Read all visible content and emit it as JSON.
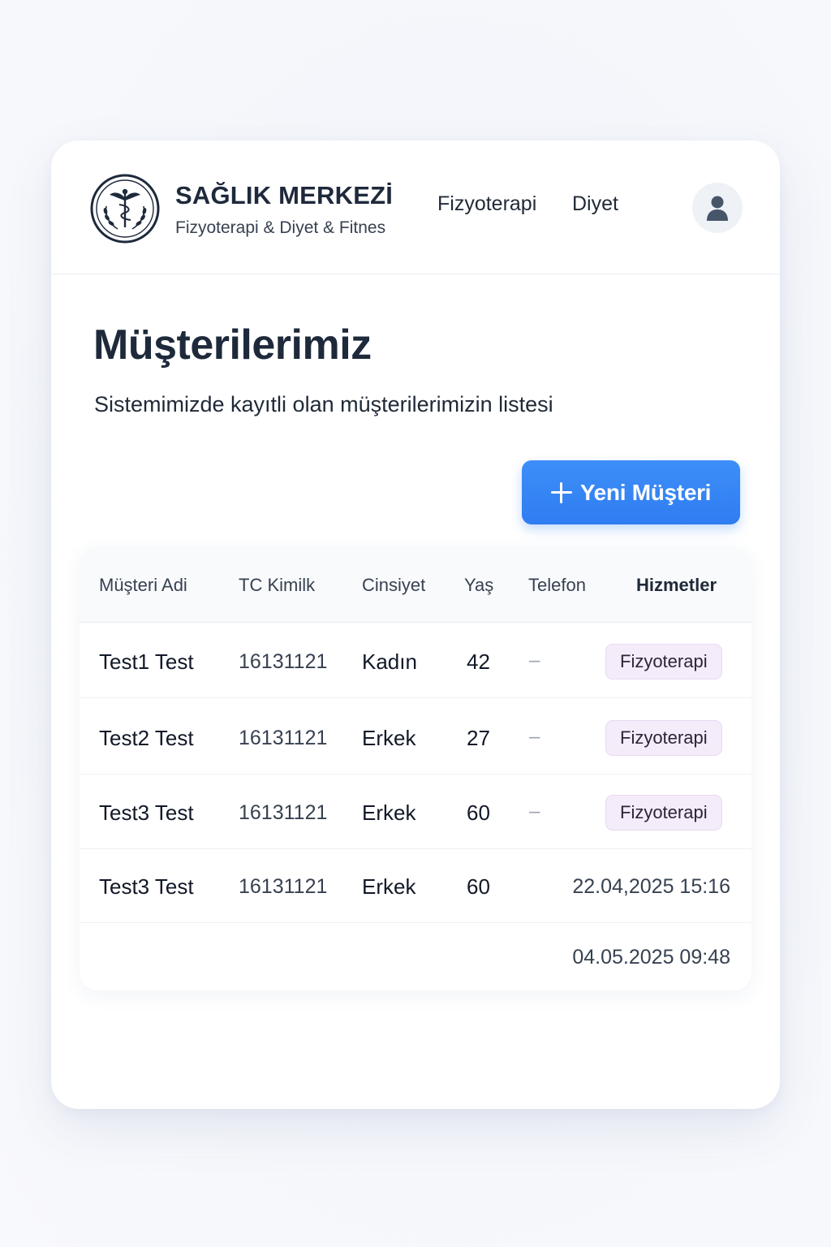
{
  "brand": {
    "title": "SAĞLIK MERKEZİ",
    "subtitle": "Fizyoterapi & Diyet & Fitnes",
    "logo_icon": "caduceus-laurel-logo"
  },
  "nav": {
    "items": [
      "Fizyoterapi",
      "Diyet"
    ],
    "avatar_icon": "user-icon"
  },
  "page": {
    "title": "Müşterilerimiz",
    "subtitle": "Sistemimizde kayıtli olan müşterilerimizin listesi"
  },
  "actions": {
    "new_customer_label": "Yeni Müşteri",
    "new_customer_icon": "plus-icon",
    "accent_color": "#3584f5"
  },
  "table": {
    "columns": [
      "Müşteri Adi",
      "TC Kimilk",
      "Cinsiyet",
      "Yaş",
      "Telefon",
      "Hizmetler"
    ],
    "rows": [
      {
        "name": "Test1 Test",
        "tc": "16131121",
        "gender": "Kadın",
        "age": "42",
        "phone": "–",
        "service": "Fizyoterapi"
      },
      {
        "name": "Test2 Test",
        "tc": "16131121",
        "gender": "Erkek",
        "age": "27",
        "phone": "–",
        "service": "Fizyoterapi"
      },
      {
        "name": "Test3 Test",
        "tc": "16131121",
        "gender": "Erkek",
        "age": "60",
        "phone": "–",
        "service": "Fizyoterapi"
      },
      {
        "name": "Test3 Test",
        "tc": "16131121",
        "gender": "Erkek",
        "age": "60",
        "date": "22.04,2025 15:16"
      },
      {
        "date": "04.05.2025 09:48"
      }
    ]
  }
}
